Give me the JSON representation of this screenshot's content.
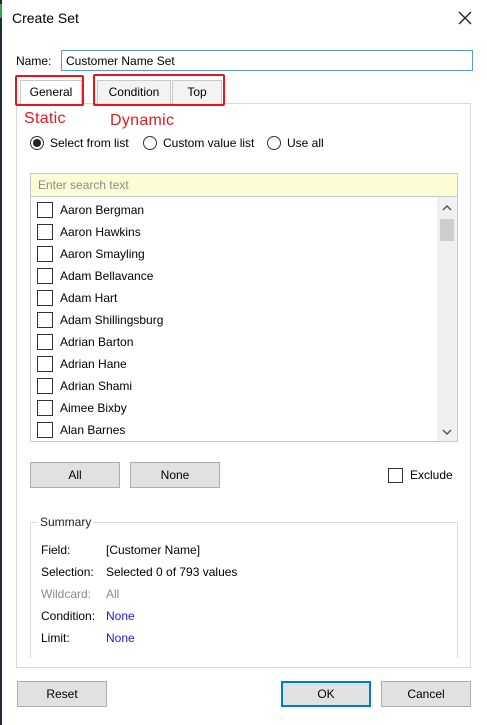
{
  "dialog": {
    "title": "Create Set"
  },
  "name_field": {
    "label": "Name:",
    "value": "Customer Name Set"
  },
  "tabs": [
    {
      "label": "General",
      "active": true
    },
    {
      "label": "Condition",
      "active": false
    },
    {
      "label": "Top",
      "active": false
    }
  ],
  "annotations": {
    "static_label": "Static",
    "dynamic_label": "Dynamic",
    "color": "#e8141c"
  },
  "selection_mode": {
    "options": [
      {
        "label": "Select from list",
        "selected": true
      },
      {
        "label": "Custom value list",
        "selected": false
      },
      {
        "label": "Use all",
        "selected": false
      }
    ]
  },
  "search": {
    "placeholder": "Enter search text",
    "value": ""
  },
  "list": {
    "items": [
      {
        "label": "Aaron Bergman",
        "checked": false
      },
      {
        "label": "Aaron Hawkins",
        "checked": false
      },
      {
        "label": "Aaron Smayling",
        "checked": false
      },
      {
        "label": "Adam Bellavance",
        "checked": false
      },
      {
        "label": "Adam Hart",
        "checked": false
      },
      {
        "label": "Adam Shillingsburg",
        "checked": false
      },
      {
        "label": "Adrian Barton",
        "checked": false
      },
      {
        "label": "Adrian Hane",
        "checked": false
      },
      {
        "label": "Adrian Shami",
        "checked": false
      },
      {
        "label": "Aimee Bixby",
        "checked": false
      },
      {
        "label": "Alan Barnes",
        "checked": false
      }
    ]
  },
  "buttons": {
    "all": "All",
    "none": "None",
    "reset": "Reset",
    "ok": "OK",
    "cancel": "Cancel"
  },
  "exclude": {
    "label": "Exclude",
    "checked": false
  },
  "summary": {
    "title": "Summary",
    "rows": [
      {
        "label": "Field:",
        "value": "[Customer Name]",
        "style": "normal"
      },
      {
        "label": "Selection:",
        "value": "Selected 0 of 793 values",
        "style": "normal"
      },
      {
        "label": "Wildcard:",
        "value": "All",
        "style": "grey"
      },
      {
        "label": "Condition:",
        "value": "None",
        "style": "blue"
      },
      {
        "label": "Limit:",
        "value": "None",
        "style": "blue"
      }
    ]
  },
  "icons": {
    "close": "close-icon",
    "scroll_up": "chevron-up-icon",
    "scroll_down": "chevron-down-icon"
  }
}
